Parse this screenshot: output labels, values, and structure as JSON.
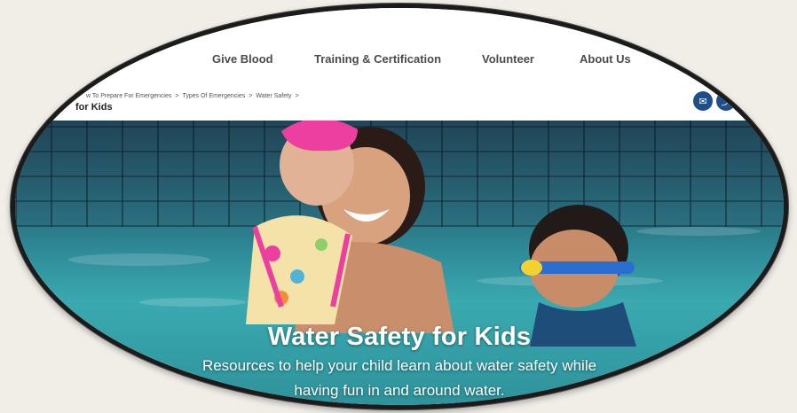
{
  "nav": {
    "items": [
      "Give Blood",
      "Training & Certification",
      "Volunteer",
      "About Us"
    ]
  },
  "breadcrumb": {
    "items": [
      "w To Prepare For Emergencies",
      "Types Of Emergencies",
      "Water Safety"
    ],
    "separator": ">",
    "current": "for Kids"
  },
  "share": {
    "icons": [
      "email-icon",
      "share-icon"
    ]
  },
  "hero": {
    "title": "Water Safety for Kids",
    "line1": "Resources to help your child learn about water safety while",
    "line2": "having fun in and around water."
  },
  "colors": {
    "nav_text": "#4b4b4b",
    "share_button": "#1e4f8a",
    "pool_water": "#3aa9b0",
    "frame": "#1b1b1b",
    "swim_cap": "#ec3fa0",
    "goggles": "#2a6fd0"
  }
}
